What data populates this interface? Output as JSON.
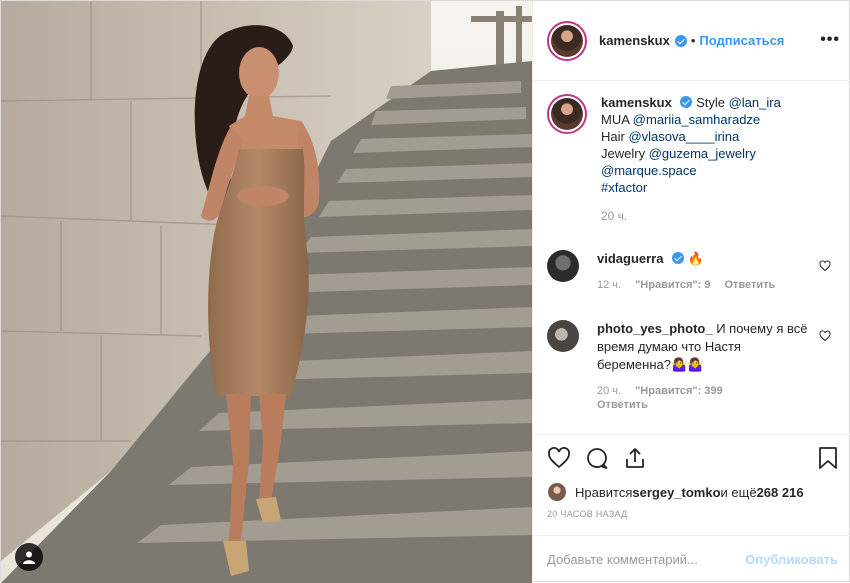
{
  "header": {
    "username": "kamenskux",
    "separator": "•",
    "follow_label": "Подписаться",
    "more_label": "•••"
  },
  "caption": {
    "username": "kamenskux",
    "line1_text": "Style ",
    "line1_mention": "@lan_ira",
    "line2_text": "MUA ",
    "line2_mention": "@mariia_samharadze",
    "line3_text": "Hair ",
    "line3_mention": "@vlasova____irina",
    "line4_text": "Jewelry ",
    "line4_mention": "@guzema_jewelry",
    "line5_mention": "@marque.space",
    "line6_mention": "#xfactor",
    "time": "20 ч."
  },
  "comments": [
    {
      "username": "vidaguerra",
      "text": "🔥",
      "time": "12 ч.",
      "likes": "\"Нравится\": 9",
      "reply": "Ответить"
    },
    {
      "username": "photo_yes_photo_",
      "text": "И почему я всё время думаю что Настя беременна?🤷‍♀️🤷‍♀️",
      "time": "20 ч.",
      "likes": "\"Нравится\": 399",
      "reply": "Ответить"
    }
  ],
  "likes": {
    "prefix": "Нравится ",
    "user": "sergey_tomko",
    "middle": " и ещё ",
    "count": "268 216"
  },
  "timestamp": "20 ЧАСОВ НАЗАД",
  "add_comment": {
    "placeholder": "Добавьте комментарий...",
    "publish_label": "Опубликовать"
  },
  "colors": {
    "link": "#3897f0",
    "mention": "#003569",
    "muted": "#999999",
    "publish_disabled": "#b3dbff"
  },
  "icons": [
    "heart-icon",
    "comment-icon",
    "share-icon",
    "bookmark-icon",
    "more-icon",
    "verified-icon",
    "tagged-user-icon"
  ]
}
